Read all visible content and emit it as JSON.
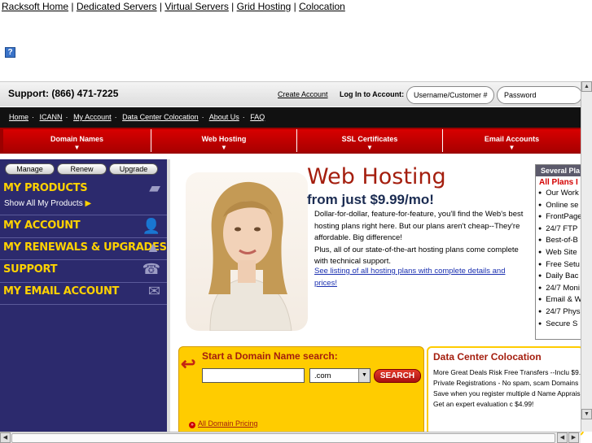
{
  "top_links": [
    "Racksoft Home",
    "Dedicated Servers",
    "Virtual Servers",
    "Grid Hosting",
    "Colocation"
  ],
  "help_icon": "?",
  "support": {
    "label": "Support: (866) 471-7225",
    "create_account": "Create Account",
    "login_label": "Log In to Account:",
    "username_placeholder": "Username/Customer #",
    "password_placeholder": "Password"
  },
  "nav": [
    "Home",
    "ICANN",
    "My Account",
    "Data Center Colocation",
    "About Us",
    "FAQ"
  ],
  "tabs": [
    "Domain Names",
    "Web Hosting",
    "SSL Certificates",
    "Email Accounts"
  ],
  "sidebar": {
    "buttons": [
      "Manage",
      "Renew",
      "Upgrade"
    ],
    "sections": [
      "MY PRODUCTS",
      "MY ACCOUNT",
      "MY RENEWALS & UPGRADES",
      "SUPPORT",
      "MY EMAIL ACCOUNT"
    ],
    "show_all": "Show All My Products"
  },
  "hero": {
    "title": "Web Hosting",
    "subtitle": "from just $9.99/mo!",
    "desc1": "Dollar-for-dollar, feature-for-feature, you'll find the Web's best hosting plans right here. But our plans aren't cheap--They're affordable. Big difference!",
    "desc2": "Plus, all of our state-of-the-art hosting plans come complete with technical support.",
    "link": "See listing of all hosting plans with complete details and prices!"
  },
  "plans": {
    "head": "Several Pla",
    "sub": "All Plans I",
    "items": [
      "Our Work",
      "Online se",
      "FrontPage",
      "24/7 FTP",
      "Best-of-B",
      "Web Site",
      "Free Setu",
      "Daily Bac",
      "24/7 Moni",
      "Email & W",
      "24/7 Phys",
      "Secure S"
    ]
  },
  "domain": {
    "title": "Start a Domain Name search:",
    "tld": ".com",
    "search": "SEARCH",
    "pricing": "All Domain Pricing"
  },
  "datacenter": {
    "title": "Data Center Colocation",
    "text": "More Great Deals Risk Free Transfers --Inclu $9.99 Private Registrations - No spam, scam Domains --Save when you register multiple d Name Appraisal --Get an expert evaluation c $4.99!"
  }
}
